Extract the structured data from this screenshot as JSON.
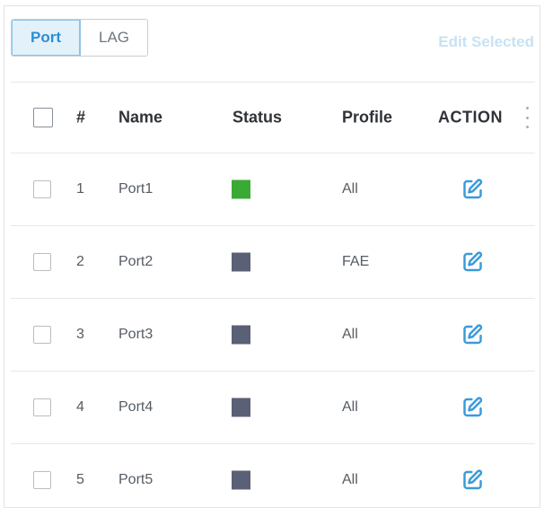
{
  "tabs": [
    {
      "label": "Port",
      "active": true
    },
    {
      "label": "LAG",
      "active": false
    }
  ],
  "toolbar": {
    "edit_selected_label": "Edit Selected"
  },
  "table": {
    "columns": {
      "number": "#",
      "name": "Name",
      "status": "Status",
      "profile": "Profile",
      "action": "ACTION"
    },
    "rows": [
      {
        "number": "1",
        "name": "Port1",
        "status_color": "#3aaa35",
        "profile": "All"
      },
      {
        "number": "2",
        "name": "Port2",
        "status_color": "#5a6075",
        "profile": "FAE"
      },
      {
        "number": "3",
        "name": "Port3",
        "status_color": "#5a6075",
        "profile": "All"
      },
      {
        "number": "4",
        "name": "Port4",
        "status_color": "#5a6075",
        "profile": "All"
      },
      {
        "number": "5",
        "name": "Port5",
        "status_color": "#5a6075",
        "profile": "All"
      }
    ]
  },
  "colors": {
    "accent": "#2a8fd4",
    "edit_icon": "#3a9bd9",
    "status_up": "#3aaa35",
    "status_down": "#5a6075"
  },
  "icons": {
    "edit": "edit-icon",
    "more": "kebab-icon"
  }
}
